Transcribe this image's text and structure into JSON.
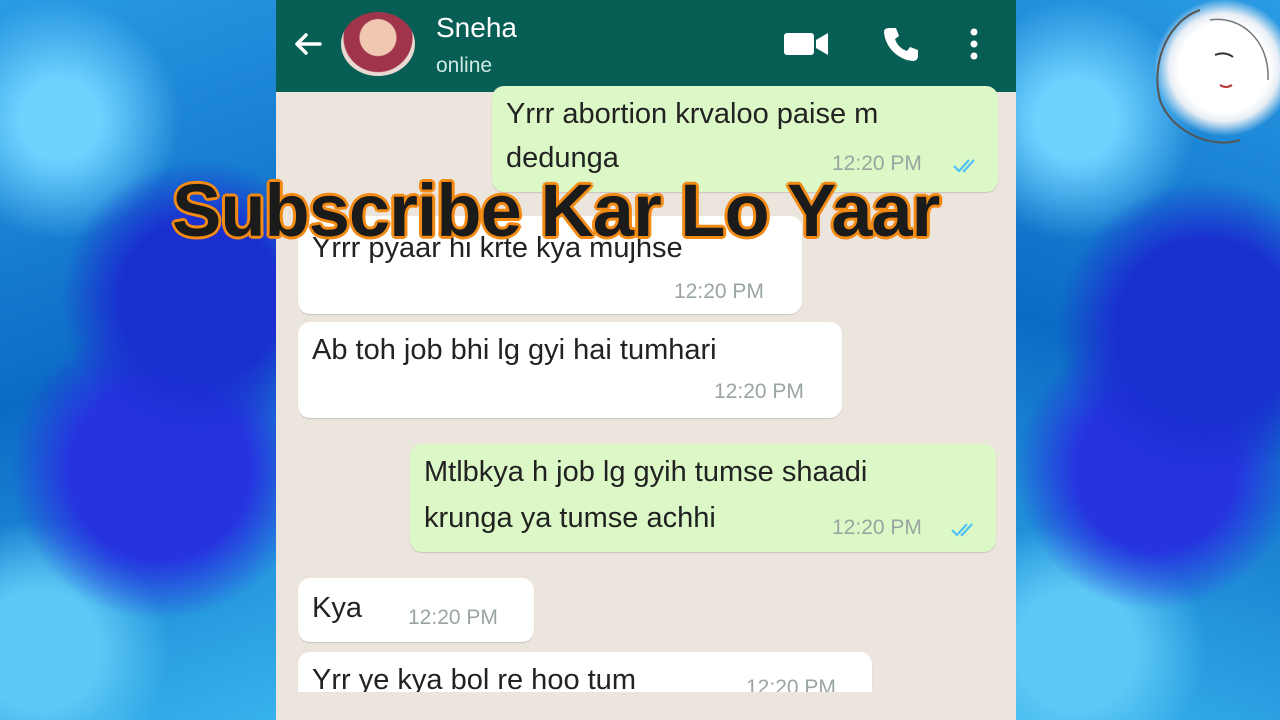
{
  "contact": {
    "name": "Sneha",
    "status": "online"
  },
  "overlay": {
    "text": "Subscribe Kar Lo Yaar"
  },
  "messages": [
    {
      "dir": "out",
      "text_lines": [
        "Yrrr abortion krvaloo paise m",
        "dedunga"
      ],
      "time": "12:20 PM",
      "read": true
    },
    {
      "dir": "in",
      "text": "Yrrr pyaar hi krte kya mujhse",
      "time": "12:20 PM"
    },
    {
      "dir": "in",
      "text": "Ab toh job bhi lg gyi hai tumhari",
      "time": "12:20 PM"
    },
    {
      "dir": "out",
      "text_lines": [
        "Mtlbkya h job lg gyih tumse shaadi",
        "krunga ya tumse achhi"
      ],
      "time": "12:20 PM",
      "read": true
    },
    {
      "dir": "in",
      "text": "Kya",
      "time": "12:20 PM"
    },
    {
      "dir": "in",
      "text": "Yrr ye kya bol re hoo tum",
      "time": "12:20 PM"
    }
  ],
  "colors": {
    "header": "#075e54",
    "outgoing": "#dcf8c6",
    "incoming": "#ffffff",
    "chat_bg": "#ece5dd",
    "overlay_outline": "#f28a14",
    "read_ticks": "#4fc3f7"
  }
}
